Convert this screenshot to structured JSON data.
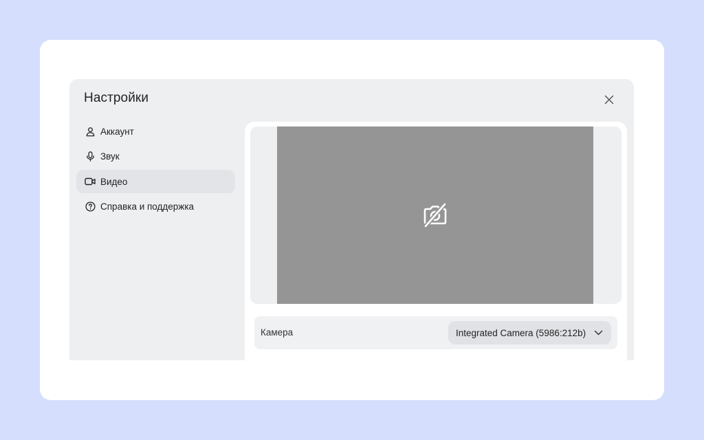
{
  "dialog": {
    "title": "Настройки",
    "close_icon": "close-icon"
  },
  "sidebar": {
    "items": [
      {
        "label": "Аккаунт",
        "icon": "user-icon",
        "active": false
      },
      {
        "label": "Звук",
        "icon": "microphone-icon",
        "active": false
      },
      {
        "label": "Видео",
        "icon": "video-camera-icon",
        "active": true
      },
      {
        "label": "Справка и поддержка",
        "icon": "help-circle-icon",
        "active": false
      }
    ]
  },
  "video": {
    "preview_icon": "camera-off-icon",
    "camera_label": "Камера",
    "camera_selected": "Integrated Camera (5986:212b)"
  },
  "colors": {
    "page_background": "#d5defc",
    "dialog_background": "#eeeff1",
    "preview_background": "#959595",
    "active_nav": "#e3e4e7"
  }
}
